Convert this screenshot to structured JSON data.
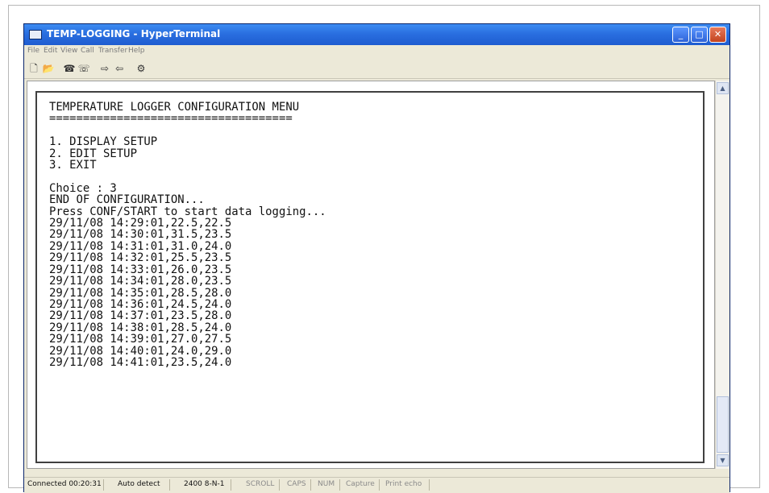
{
  "window": {
    "title": "TEMP-LOGGING - HyperTerminal",
    "controls": {
      "minimize": "_",
      "maximize": "□",
      "close": "✕"
    }
  },
  "menu": [
    "File",
    "Edit",
    "View",
    "Call",
    "Transfer",
    "Help"
  ],
  "toolbar": [
    {
      "name": "new-connection-icon",
      "glyph": "🗋"
    },
    {
      "name": "open-icon",
      "glyph": "📂"
    },
    {
      "name": "connect-icon",
      "glyph": "☎"
    },
    {
      "name": "disconnect-icon",
      "glyph": "☏"
    },
    {
      "name": "send-icon",
      "glyph": "⇨"
    },
    {
      "name": "receive-icon",
      "glyph": "⇦"
    },
    {
      "name": "properties-icon",
      "glyph": "⚙"
    }
  ],
  "terminal": {
    "lines": [
      "TEMPERATURE LOGGER CONFIGURATION MENU",
      "====================================",
      "",
      "1. DISPLAY SETUP",
      "2. EDIT SETUP",
      "3. EXIT",
      "",
      "Choice : 3",
      "END OF CONFIGURATION...",
      "Press CONF/START to start data logging...",
      "29/11/08 14:29:01,22.5,22.5",
      "29/11/08 14:30:01,31.5,23.5",
      "29/11/08 14:31:01,31.0,24.0",
      "29/11/08 14:32:01,25.5,23.5",
      "29/11/08 14:33:01,26.0,23.5",
      "29/11/08 14:34:01,28.0,23.5",
      "29/11/08 14:35:01,28.5,28.0",
      "29/11/08 14:36:01,24.5,24.0",
      "29/11/08 14:37:01,23.5,28.0",
      "29/11/08 14:38:01,28.5,24.0",
      "29/11/08 14:39:01,27.0,27.5",
      "29/11/08 14:40:01,24.0,29.0",
      "29/11/08 14:41:01,23.5,24.0"
    ]
  },
  "scrollbar": {
    "up": "▲",
    "down": "▼"
  },
  "status": {
    "connected": "Connected 00:20:31",
    "detect": "Auto detect",
    "settings": "2400 8-N-1",
    "scroll": "SCROLL",
    "caps": "CAPS",
    "num": "NUM",
    "capture": "Capture",
    "print_echo": "Print echo"
  },
  "colors": {
    "titlebar": "#2a6fe0",
    "chrome": "#ece9d8",
    "text_disabled": "#8a8a8a"
  }
}
